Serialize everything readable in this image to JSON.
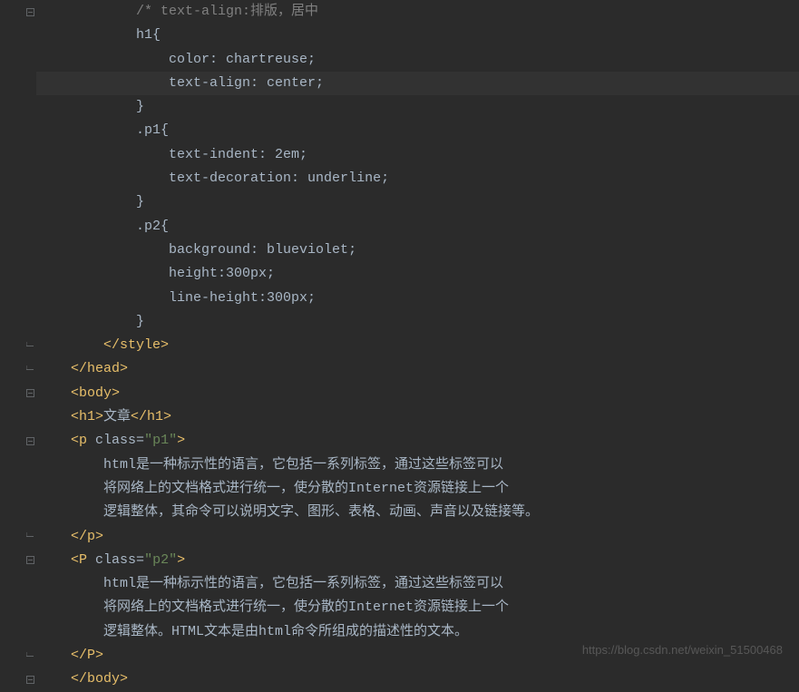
{
  "lines": [
    {
      "indent": "            ",
      "tokens": [
        {
          "cls": "comment",
          "text": "/* text-align:排版，居中"
        }
      ]
    },
    {
      "indent": "            ",
      "tokens": [
        {
          "cls": "text",
          "text": "h1{"
        }
      ]
    },
    {
      "indent": "                ",
      "tokens": [
        {
          "cls": "text",
          "text": "color: chartreuse;"
        }
      ]
    },
    {
      "indent": "                ",
      "tokens": [
        {
          "cls": "text",
          "text": "text-align: center;"
        }
      ],
      "highlight": true
    },
    {
      "indent": "            ",
      "tokens": [
        {
          "cls": "text",
          "text": "}"
        }
      ]
    },
    {
      "indent": "            ",
      "tokens": [
        {
          "cls": "text",
          "text": ".p1{"
        }
      ]
    },
    {
      "indent": "                ",
      "tokens": [
        {
          "cls": "text",
          "text": "text-indent: 2em;"
        }
      ]
    },
    {
      "indent": "                ",
      "tokens": [
        {
          "cls": "text",
          "text": "text-decoration: underline;"
        }
      ]
    },
    {
      "indent": "            ",
      "tokens": [
        {
          "cls": "text",
          "text": "}"
        }
      ]
    },
    {
      "indent": "            ",
      "tokens": [
        {
          "cls": "text",
          "text": ".p2{"
        }
      ]
    },
    {
      "indent": "                ",
      "tokens": [
        {
          "cls": "text",
          "text": "background: blueviolet;"
        }
      ]
    },
    {
      "indent": "                ",
      "tokens": [
        {
          "cls": "text",
          "text": "height:300px;"
        }
      ]
    },
    {
      "indent": "                ",
      "tokens": [
        {
          "cls": "text",
          "text": "line-height:300px;"
        }
      ]
    },
    {
      "indent": "            ",
      "tokens": [
        {
          "cls": "text",
          "text": "}"
        }
      ]
    },
    {
      "indent": "        ",
      "tokens": [
        {
          "cls": "tag",
          "text": "</style>"
        }
      ]
    },
    {
      "indent": "    ",
      "tokens": [
        {
          "cls": "tag",
          "text": "</head>"
        }
      ]
    },
    {
      "indent": "    ",
      "tokens": [
        {
          "cls": "tag",
          "text": "<body>"
        }
      ]
    },
    {
      "indent": "    ",
      "tokens": [
        {
          "cls": "tag",
          "text": "<h1>"
        },
        {
          "cls": "text",
          "text": "文章"
        },
        {
          "cls": "tag",
          "text": "</h1>"
        }
      ]
    },
    {
      "indent": "    ",
      "tokens": [
        {
          "cls": "tag",
          "text": "<p "
        },
        {
          "cls": "attr-name",
          "text": "class"
        },
        {
          "cls": "text",
          "text": "="
        },
        {
          "cls": "attr-value",
          "text": "\"p1\""
        },
        {
          "cls": "tag",
          "text": ">"
        }
      ]
    },
    {
      "indent": "        ",
      "tokens": [
        {
          "cls": "text",
          "text": "html是一种标示性的语言，它包括一系列标签，通过这些标签可以"
        }
      ]
    },
    {
      "indent": "        ",
      "tokens": [
        {
          "cls": "text",
          "text": "将网络上的文档格式进行统一，使分散的Internet资源链接上一个"
        }
      ]
    },
    {
      "indent": "        ",
      "tokens": [
        {
          "cls": "text",
          "text": "逻辑整体，其命令可以说明文字、图形、表格、动画、声音以及链接等。"
        }
      ]
    },
    {
      "indent": "    ",
      "tokens": [
        {
          "cls": "tag",
          "text": "</p>"
        }
      ]
    },
    {
      "indent": "    ",
      "tokens": [
        {
          "cls": "tag",
          "text": "<P "
        },
        {
          "cls": "attr-name",
          "text": "class"
        },
        {
          "cls": "text",
          "text": "="
        },
        {
          "cls": "attr-value",
          "text": "\"p2\""
        },
        {
          "cls": "tag",
          "text": ">"
        }
      ]
    },
    {
      "indent": "        ",
      "tokens": [
        {
          "cls": "text",
          "text": "html是一种标示性的语言，它包括一系列标签，通过这些标签可以"
        }
      ]
    },
    {
      "indent": "        ",
      "tokens": [
        {
          "cls": "text",
          "text": "将网络上的文档格式进行统一，使分散的Internet资源链接上一个"
        }
      ]
    },
    {
      "indent": "        ",
      "tokens": [
        {
          "cls": "text",
          "text": "逻辑整体。HTML文本是由html命令所组成的描述性的文本。"
        }
      ]
    },
    {
      "indent": "    ",
      "tokens": [
        {
          "cls": "tag",
          "text": "</P>"
        }
      ]
    },
    {
      "indent": "    ",
      "tokens": [
        {
          "cls": "tag",
          "text": "</body>"
        }
      ]
    }
  ],
  "gutter_icons": [
    {
      "line": 0,
      "type": "collapse"
    },
    {
      "line": 14,
      "type": "end"
    },
    {
      "line": 15,
      "type": "end"
    },
    {
      "line": 16,
      "type": "collapse"
    },
    {
      "line": 18,
      "type": "collapse"
    },
    {
      "line": 22,
      "type": "end"
    },
    {
      "line": 23,
      "type": "collapse"
    },
    {
      "line": 27,
      "type": "end"
    },
    {
      "line": 28,
      "type": "collapse"
    }
  ],
  "watermark": "https://blog.csdn.net/weixin_51500468"
}
